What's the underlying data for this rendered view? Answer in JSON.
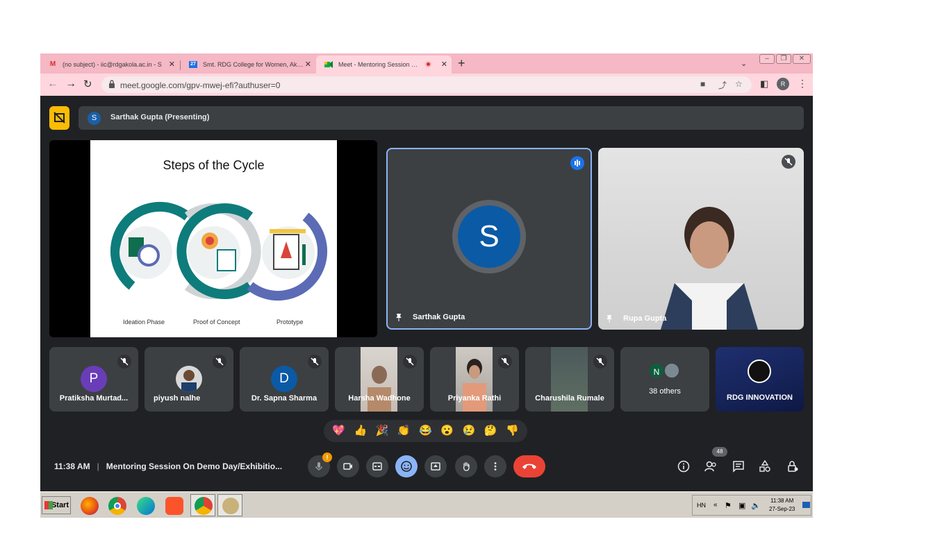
{
  "browser": {
    "tabs": [
      {
        "title": "(no subject) - iic@rdgakola.ac.in - S",
        "icon": "gmail-icon"
      },
      {
        "title": "Smt. RDG College for Women, Akola",
        "icon": "calendar-icon",
        "badge": "27"
      },
      {
        "title": "Meet - Mentoring Session On De",
        "icon": "meet-icon"
      }
    ],
    "url": "meet.google.com/gpv-mwej-efi?authuser=0",
    "profile_initial": "R"
  },
  "meet": {
    "presenter_initial": "S",
    "presenter_label": "Sarthak Gupta (Presenting)",
    "slide": {
      "title": "Steps of the Cycle",
      "phases": [
        "Ideation Phase",
        "Proof of Concept",
        "Prototype"
      ]
    },
    "main_tiles": [
      {
        "name": "Sarthak Gupta",
        "initial": "S"
      },
      {
        "name": "Rupa Gupta"
      }
    ],
    "participants": [
      {
        "name": "Pratiksha Murtad...",
        "initial": "P"
      },
      {
        "name": "piyush nalhe"
      },
      {
        "name": "Dr. Sapna Sharma",
        "initial": "D"
      },
      {
        "name": "Harsha Wadhone"
      },
      {
        "name": "Priyanka Rathi"
      },
      {
        "name": "Charushila Rumale"
      },
      {
        "name": "38 others",
        "initial": "N"
      },
      {
        "name": "RDG INNOVATION"
      }
    ],
    "reactions": [
      "💖",
      "👍",
      "🎉",
      "👏",
      "😂",
      "😮",
      "😢",
      "🤔",
      "👎"
    ],
    "time": "11:38 AM",
    "meeting_title": "Mentoring Session On Demo Day/Exhibitio...",
    "participant_count": "48",
    "mic_alert": "!"
  },
  "taskbar": {
    "start_label": "Start",
    "language": "HN",
    "clock_time": "11:38 AM",
    "clock_date": "27-Sep-23"
  }
}
